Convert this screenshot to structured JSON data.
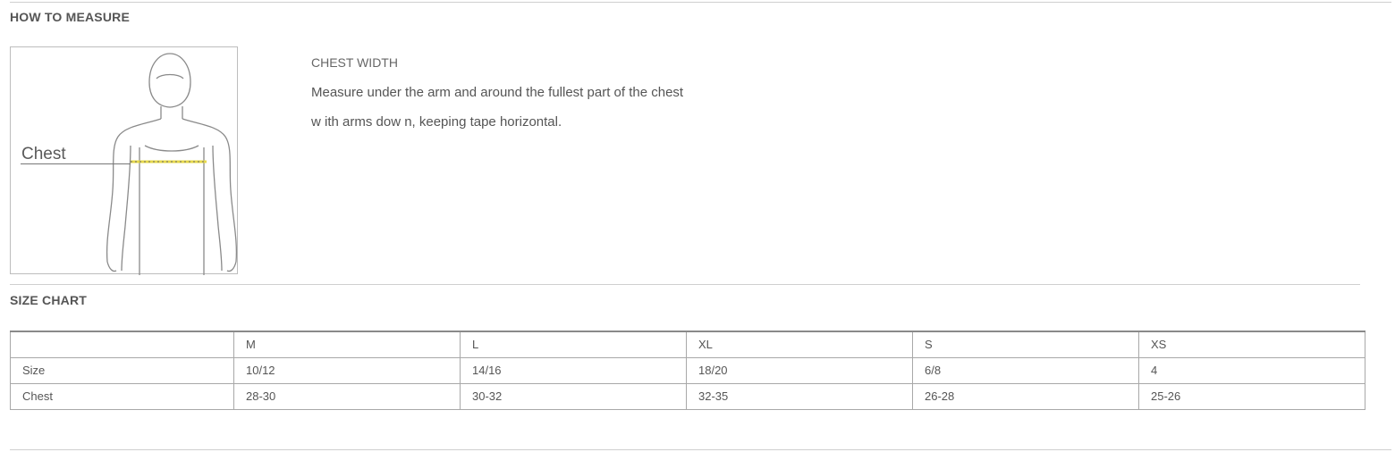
{
  "how_to_measure": {
    "heading": "HOW TO MEASURE",
    "figure_label": "Chest",
    "measure_title": "CHEST WIDTH",
    "measure_line1": "Measure under the arm and around the fullest part of the chest",
    "measure_line2": "w ith arms dow n, keeping tape horizontal.",
    "tape_color": "#e6d84a"
  },
  "size_chart": {
    "heading": "SIZE CHART",
    "columns": [
      "M",
      "L",
      "XL",
      "S",
      "XS"
    ],
    "rows": [
      {
        "label": "Size",
        "values": [
          "10/12",
          "14/16",
          "18/20",
          "6/8",
          "4"
        ]
      },
      {
        "label": "Chest",
        "values": [
          "28-30",
          "30-32",
          "32-35",
          "26-28",
          "25-26"
        ]
      }
    ]
  }
}
